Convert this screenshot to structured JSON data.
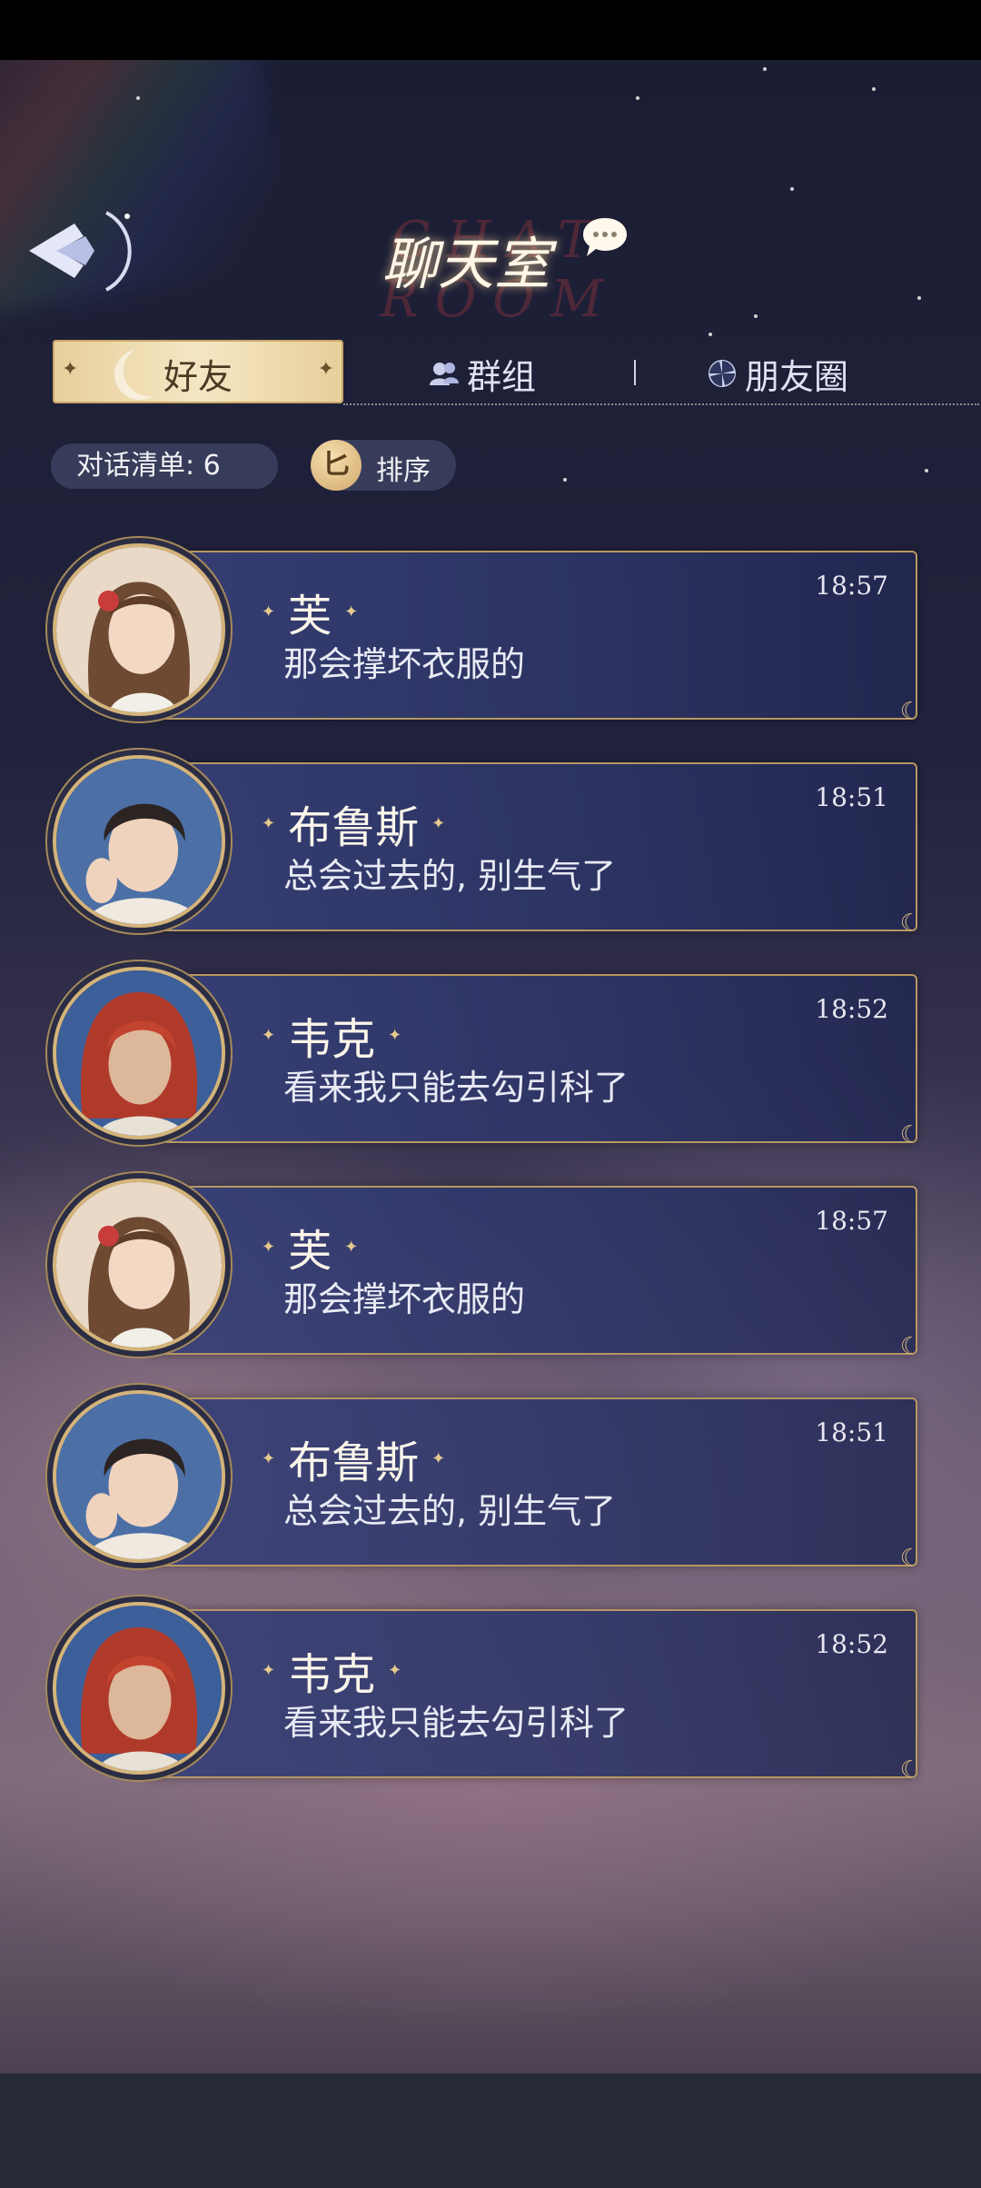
{
  "header": {
    "title_en": "CHAT ROOM",
    "title_cn": "聊天室"
  },
  "tabs": [
    {
      "label": "好友",
      "icon": "moon-icon",
      "active": true
    },
    {
      "label": "群组",
      "icon": "group-icon",
      "active": false
    },
    {
      "label": "朋友圈",
      "icon": "pinwheel-icon",
      "active": false
    }
  ],
  "toolbar": {
    "count_label": "对话清单: 6",
    "sort_icon_char": "匕",
    "sort_label": "排序"
  },
  "chats": [
    {
      "name": "芙",
      "message": "那会撑坏衣服的",
      "time": "18:57",
      "avatar": "girl-brown-hair"
    },
    {
      "name": "布鲁斯",
      "message": "总会过去的, 别生气了",
      "time": "18:51",
      "avatar": "man-dark-hair"
    },
    {
      "name": "韦克",
      "message": "看来我只能去勾引科了",
      "time": "18:52",
      "avatar": "man-red-hair"
    },
    {
      "name": "芙",
      "message": "那会撑坏衣服的",
      "time": "18:57",
      "avatar": "girl-brown-hair"
    },
    {
      "name": "布鲁斯",
      "message": "总会过去的, 别生气了",
      "time": "18:51",
      "avatar": "man-dark-hair"
    },
    {
      "name": "韦克",
      "message": "看来我只能去勾引科了",
      "time": "18:52",
      "avatar": "man-red-hair"
    }
  ],
  "colors": {
    "accent_gold": "#d4b47a",
    "card_blue": "#374078",
    "tab_active_bg": "#f5e6c3"
  }
}
